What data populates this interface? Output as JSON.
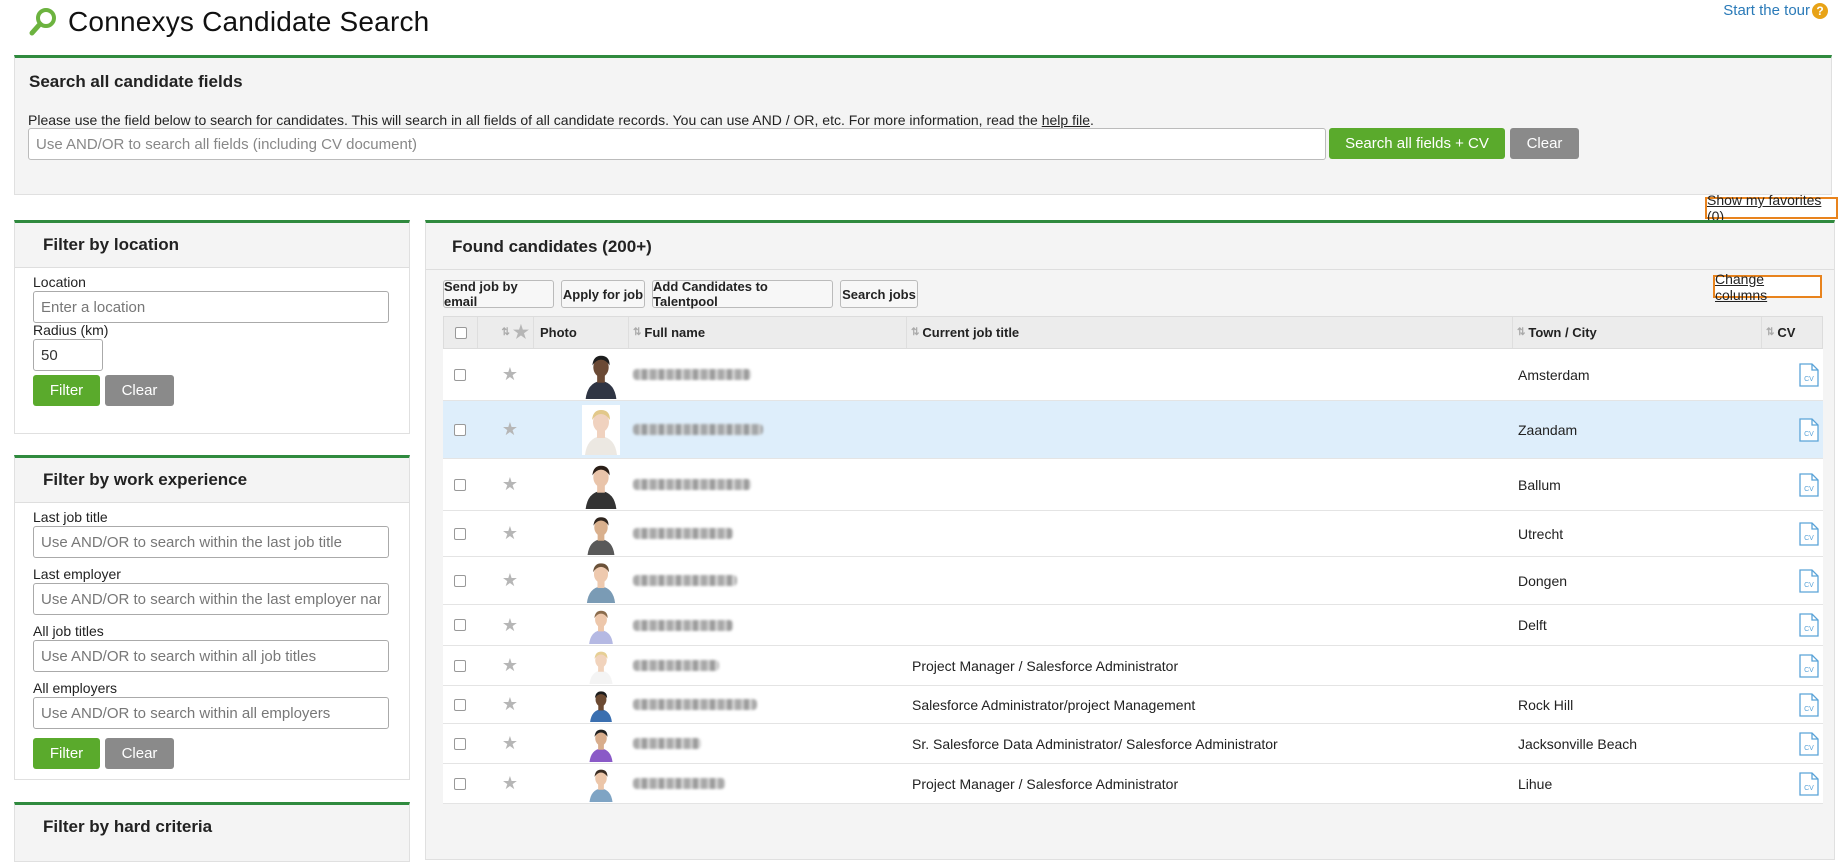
{
  "app": {
    "title": "Connexys Candidate Search",
    "tour_label": "Start the tour",
    "tour_icon": "question-icon",
    "accent_green": "#5aaa2c",
    "highlight_orange": "#e8831d"
  },
  "search": {
    "heading": "Search all candidate fields",
    "description": "Please use the field below to search for candidates. This will search in all fields of all candidate records. You can use AND / OR, etc. For more information, read the",
    "help_link": "help file",
    "placeholder": "Use AND/OR to search all fields (including CV document)",
    "value": "",
    "search_button": "Search all fields + CV",
    "clear_button": "Clear"
  },
  "favorites_link": "Show my favorites (0)",
  "filters": {
    "location": {
      "heading": "Filter by location",
      "location_label": "Location",
      "location_placeholder": "Enter a location",
      "radius_label": "Radius (km)",
      "radius_value": "50",
      "filter_button": "Filter",
      "clear_button": "Clear"
    },
    "work_experience": {
      "heading": "Filter by work experience",
      "last_job_title_label": "Last job title",
      "last_job_title_placeholder": "Use AND/OR to search within the last job title",
      "last_employer_label": "Last employer",
      "last_employer_placeholder": "Use AND/OR to search within the last employer name",
      "all_job_titles_label": "All job titles",
      "all_job_titles_placeholder": "Use AND/OR to search within all job titles",
      "all_employers_label": "All employers",
      "all_employers_placeholder": "Use AND/OR to search within all employers",
      "filter_button": "Filter",
      "clear_button": "Clear"
    },
    "hard_criteria": {
      "heading": "Filter by hard criteria"
    }
  },
  "results": {
    "heading": "Found candidates (200+)",
    "actions": [
      "Send job by email",
      "Apply for job",
      "Add Candidates to Talentpool",
      "Search jobs"
    ],
    "change_columns_link": "Change columns",
    "columns": {
      "photo": "Photo",
      "full_name": "Full name",
      "job_title": "Current job title",
      "town": "Town / City",
      "cv": "CV"
    },
    "cv_icon_label": "CV",
    "rows": [
      {
        "job_title": "",
        "town": "Amsterdam",
        "avatar": {
          "skin": "#6b4a35",
          "hair": "#1d1d1d",
          "shirt": "#2f3544"
        }
      },
      {
        "job_title": "",
        "town": "Zaandam",
        "avatar": {
          "skin": "#f0d2bf",
          "hair": "#e2c88a",
          "shirt": "#ece8e2"
        }
      },
      {
        "job_title": "",
        "town": "Ballum",
        "avatar": {
          "skin": "#e9c4aa",
          "hair": "#2a1e17",
          "shirt": "#333333"
        }
      },
      {
        "job_title": "",
        "town": "Utrecht",
        "avatar": {
          "skin": "#d9b08d",
          "hair": "#2e241d",
          "shirt": "#595959"
        }
      },
      {
        "job_title": "",
        "town": "Dongen",
        "avatar": {
          "skin": "#eec9ae",
          "hair": "#6a5138",
          "shirt": "#7a9bb5"
        }
      },
      {
        "job_title": "",
        "town": "Delft",
        "avatar": {
          "skin": "#edc7ab",
          "hair": "#8a6b4c",
          "shirt": "#b5b9e3"
        }
      },
      {
        "job_title": "Project Manager / Salesforce Administrator",
        "town": "",
        "avatar": {
          "skin": "#f1d3bc",
          "hair": "#e6cf94",
          "shirt": "#f4f4f4"
        }
      },
      {
        "job_title": "Salesforce Administrator/project Management",
        "town": "Rock Hill",
        "avatar": {
          "skin": "#6c4a32",
          "hair": "#1c1c1c",
          "shirt": "#3a6fb0"
        }
      },
      {
        "job_title": "Sr. Salesforce Data Administrator/ Salesforce Administrator",
        "town": "Jacksonville Beach",
        "avatar": {
          "skin": "#d8ad8c",
          "hair": "#202020",
          "shirt": "#8a5ac7"
        }
      },
      {
        "job_title": "Project Manager / Salesforce Administrator",
        "town": "Lihue",
        "avatar": {
          "skin": "#ecc6a9",
          "hair": "#3a2c22",
          "shirt": "#7fa4c4"
        }
      }
    ]
  }
}
